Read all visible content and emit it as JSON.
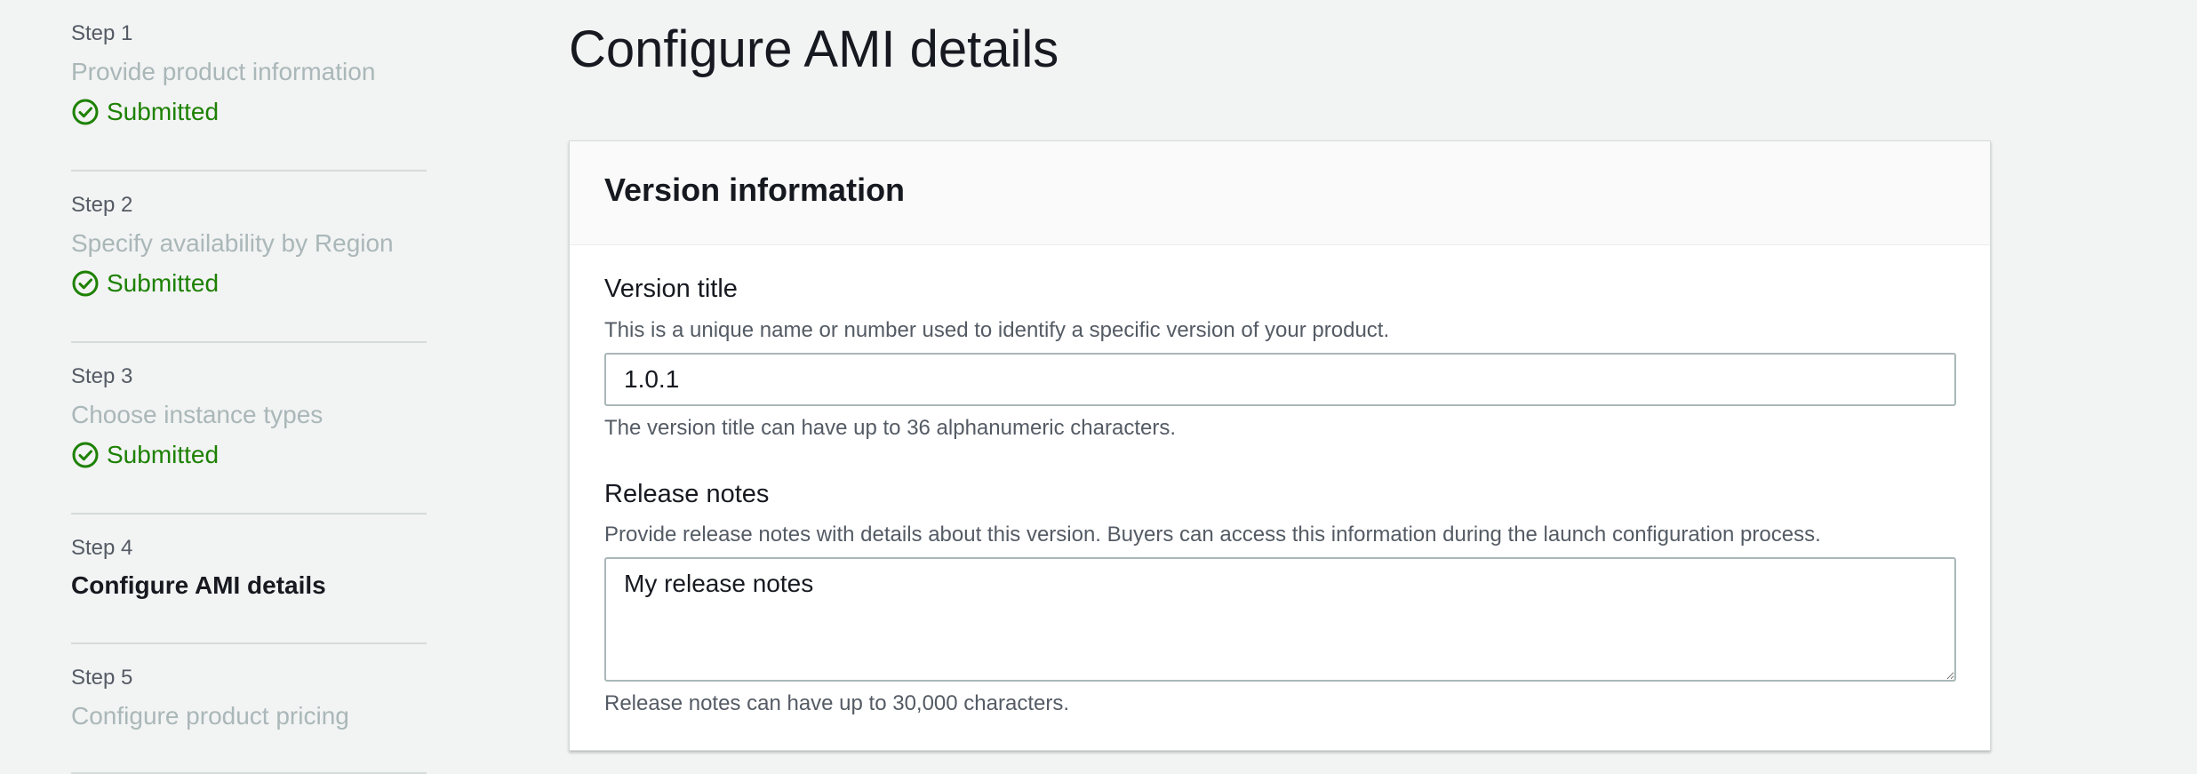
{
  "sidebar": {
    "steps": [
      {
        "step": "Step 1",
        "title": "Provide product information",
        "status": "Submitted"
      },
      {
        "step": "Step 2",
        "title": "Specify availability by Region",
        "status": "Submitted"
      },
      {
        "step": "Step 3",
        "title": "Choose instance types",
        "status": "Submitted"
      },
      {
        "step": "Step 4",
        "title": "Configure AMI details",
        "status": ""
      },
      {
        "step": "Step 5",
        "title": "Configure product pricing",
        "status": ""
      }
    ]
  },
  "main": {
    "page_title": "Configure AMI details",
    "panel": {
      "title": "Version information",
      "version_title": {
        "label": "Version title",
        "description": "This is a unique name or number used to identify a specific version of your product.",
        "value": "1.0.1",
        "constraint": "The version title can have up to 36 alphanumeric characters."
      },
      "release_notes": {
        "label": "Release notes",
        "description": "Provide release notes with details about this version. Buyers can access this information during the launch configuration process.",
        "value": "My release notes",
        "constraint": "Release notes can have up to 30,000 characters."
      }
    }
  },
  "colors": {
    "success": "#1d8102",
    "muted": "#aab7b8",
    "text": "#16191f"
  }
}
